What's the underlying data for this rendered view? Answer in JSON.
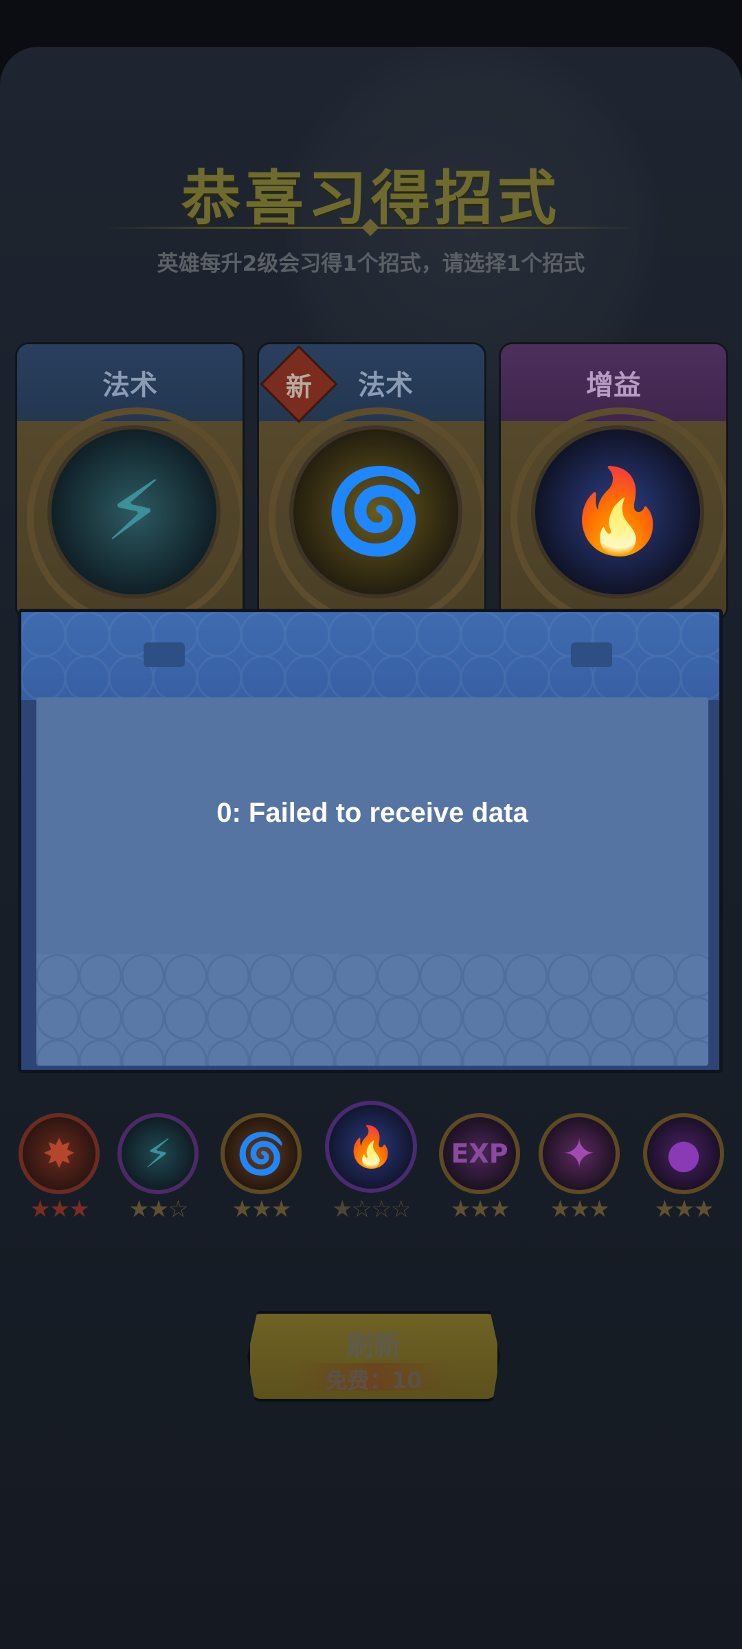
{
  "header": {
    "title": "恭喜习得招式",
    "subtitle": "英雄每升2级会习得1个招式，请选择1个招式"
  },
  "cards": [
    {
      "type": "法术",
      "badge": "",
      "icon": "lightning-face-icon"
    },
    {
      "type": "法术",
      "badge": "新",
      "icon": "golden-tornado-icon"
    },
    {
      "type": "增益",
      "badge": "",
      "icon": "blue-flame-icon"
    }
  ],
  "modal": {
    "message": "0: Failed to receive data"
  },
  "skills": [
    {
      "stars": "★★★",
      "rating": 3,
      "icon": "red-burst-icon"
    },
    {
      "stars": "★★☆",
      "rating": 2,
      "icon": "lightning-face-icon"
    },
    {
      "stars": "★★★",
      "rating": 3,
      "icon": "orange-tornado-icon"
    },
    {
      "stars": "★☆☆☆",
      "rating": 1,
      "icon": "blue-flame-icon"
    },
    {
      "stars": "★★★",
      "rating": 3,
      "icon": "exp-bomb-icon"
    },
    {
      "stars": "★★★",
      "rating": 3,
      "icon": "purple-spirit-icon"
    },
    {
      "stars": "★★★",
      "rating": 3,
      "icon": "purple-orb-icon"
    }
  ],
  "refresh": {
    "label": "刷新",
    "cost": "免费：10"
  },
  "colors": {
    "title": "#6f6a2e",
    "modal_body": "#5574a2",
    "refresh_button": "#6e6224"
  }
}
